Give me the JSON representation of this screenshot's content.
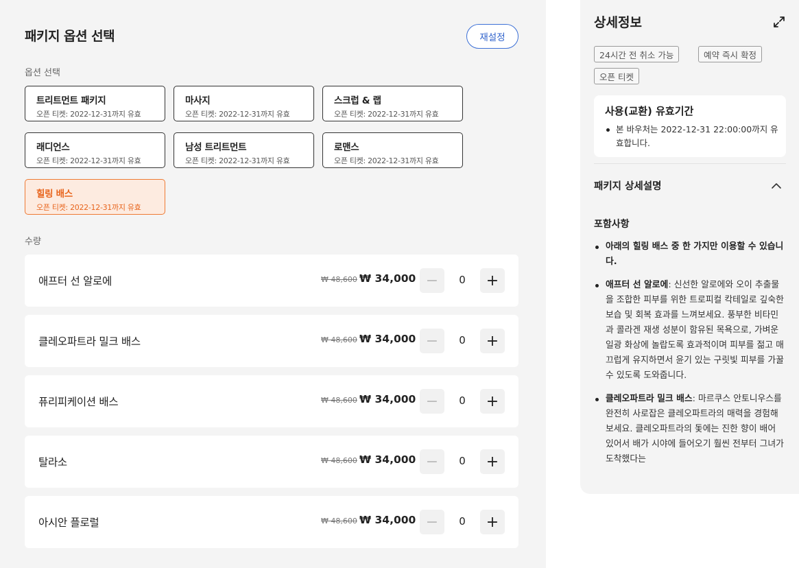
{
  "left": {
    "title": "패키지 옵션 선택",
    "reset_label": "재설정",
    "option_section_label": "옵션 선택",
    "options": [
      {
        "name": "트리트먼트 패키지",
        "sub": "오픈 티켓: 2022-12-31까지 유효",
        "selected": false
      },
      {
        "name": "마사지",
        "sub": "오픈 티켓: 2022-12-31까지 유효",
        "selected": false
      },
      {
        "name": "스크럽 & 랩",
        "sub": "오픈 티켓: 2022-12-31까지 유효",
        "selected": false
      },
      {
        "name": "래디언스",
        "sub": "오픈 티켓: 2022-12-31까지 유효",
        "selected": false
      },
      {
        "name": "남성 트리트먼트",
        "sub": "오픈 티켓: 2022-12-31까지 유효",
        "selected": false
      },
      {
        "name": "로맨스",
        "sub": "오픈 티켓: 2022-12-31까지 유효",
        "selected": false
      },
      {
        "name": "힐링 배스",
        "sub": "오픈 티켓: 2022-12-31까지 유효",
        "selected": true
      }
    ],
    "quantity_section_label": "수량",
    "products": [
      {
        "name": "애프터 선 알로에",
        "old_price": "₩ 48,600",
        "price": "₩ 34,000",
        "minus": "−",
        "count": "0",
        "plus": "+"
      },
      {
        "name": "클레오파트라 밀크 배스",
        "old_price": "₩ 48,600",
        "price": "₩ 34,000",
        "minus": "−",
        "count": "0",
        "plus": "+"
      },
      {
        "name": "퓨리피케이션 배스",
        "old_price": "₩ 48,600",
        "price": "₩ 34,000",
        "minus": "−",
        "count": "0",
        "plus": "+"
      },
      {
        "name": "탈라소",
        "old_price": "₩ 48,600",
        "price": "₩ 34,000",
        "minus": "−",
        "count": "0",
        "plus": "+"
      },
      {
        "name": "아시안 플로럴",
        "old_price": "₩ 48,600",
        "price": "₩ 34,000",
        "minus": "−",
        "count": "0",
        "plus": "+"
      }
    ]
  },
  "right": {
    "title": "상세정보",
    "expand_icon": "expand-icon",
    "tags": [
      "24시간 전 취소 가능",
      "예약 즉시 확정",
      "오픈 티켓"
    ],
    "validity_title": "사용(교환) 유효기간",
    "validity_text": "본 바우처는 2022-12-31 22:00:00까지 유효합니다.",
    "desc_heading": "패키지 상세설명",
    "collapse_icon": "chevron-up-icon",
    "include_heading": "포함사항",
    "items": [
      {
        "bold": "아래의 힐링 배스 중 한 가지만 이용할 수 있습니다.",
        "text": ""
      },
      {
        "bold": "애프터 선 알로에",
        "text": ": 신선한 알로에와 오이 추출물을 조합한 피부를 위한 트로피컬 칵테일로 깊숙한 보습 및 회복 효과를 느껴보세요. 풍부한 비타민과 콜라겐 재생 성분이 함유된 목욕으로, 가벼운 일광 화상에 놀랍도록 효과적이며 피부를 젊고 매끄럽게 유지하면서 윤기 있는 구릿빛 피부를 가꿀 수 있도록 도와줍니다."
      },
      {
        "bold": "클레오파트라 밀크 배스",
        "text": ": 마르쿠스 안토니우스를 완전히 사로잡은 클레오파트라의 매력을 경험해보세요. 클레오파트라의 돛에는 진한 향이 배어 있어서 배가 시야에 들어오기 훨씬 전부터 그녀가 도착했다는"
      }
    ]
  }
}
